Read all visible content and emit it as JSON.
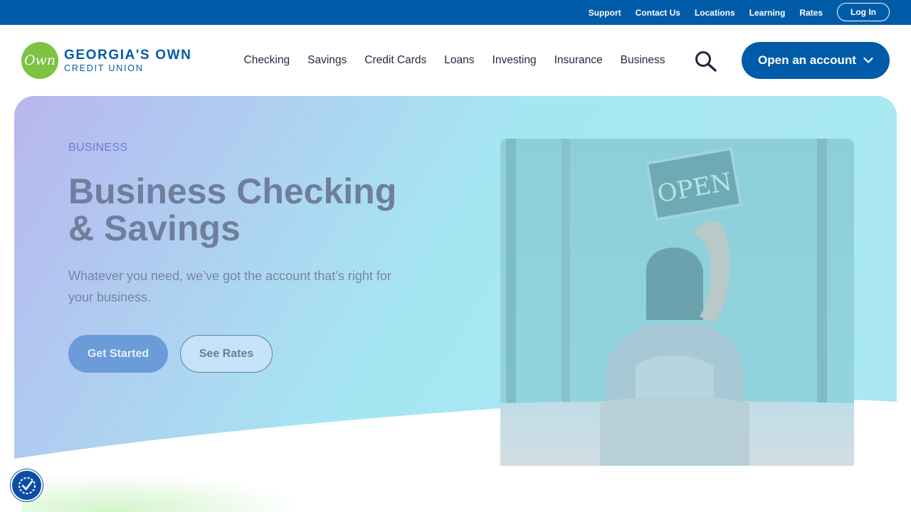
{
  "utility_nav": {
    "links": [
      "Support",
      "Contact Us",
      "Locations",
      "Learning",
      "Rates"
    ],
    "login_label": "Log In"
  },
  "brand": {
    "mark_text": "Own",
    "name": "GEORGIA'S OWN",
    "subtitle": "CREDIT UNION"
  },
  "main_nav": {
    "items": [
      "Checking",
      "Savings",
      "Credit Cards",
      "Loans",
      "Investing",
      "Insurance",
      "Business"
    ],
    "search_icon": "search-icon",
    "cta_label": "Open an account",
    "cta_icon": "chevron-down-icon"
  },
  "hero": {
    "eyebrow": "BUSINESS",
    "title_line1": "Business Checking",
    "title_line2": "& Savings",
    "subtitle": "Whatever you need, we’ve got the account that’s right for your business.",
    "primary_button": "Get Started",
    "secondary_button": "See Rates",
    "photo_sign_text": "OPEN"
  },
  "accessibility": {
    "icon": "accessibility-icon"
  },
  "colors": {
    "brand_blue": "#005ba8",
    "brand_green": "#7dc243",
    "hero_gradient_start": "#b7b8ef",
    "hero_gradient_end": "#a6e7f3"
  }
}
